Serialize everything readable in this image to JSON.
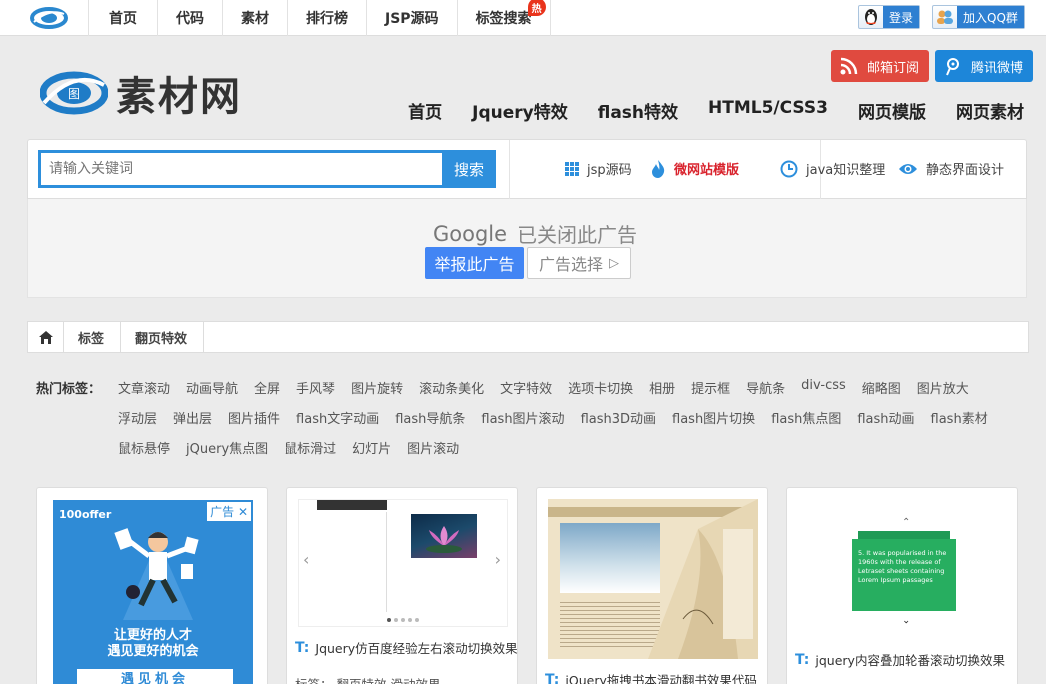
{
  "top_nav": {
    "items": [
      "首页",
      "代码",
      "素材",
      "排行榜",
      "JSP源码",
      "标签搜索"
    ],
    "hot_badge": "热",
    "login_label": "登录",
    "qq_group_label": "加入QQ群"
  },
  "brand": {
    "name": "素材网",
    "logo_mark": "图"
  },
  "subscribe": {
    "email_label": "邮箱订阅",
    "weibo_label": "腾讯微博"
  },
  "main_nav": {
    "items": [
      "首页",
      "Jquery特效",
      "flash特效",
      "HTML5/CSS3",
      "网页模版",
      "网页素材"
    ]
  },
  "search": {
    "placeholder": "请输入关键词",
    "button": "搜索"
  },
  "quick_links": [
    {
      "label": "jsp源码",
      "icon": "grid-icon"
    },
    {
      "label": "微网站模版",
      "icon": "flame-icon",
      "color": "#d9232d"
    },
    {
      "label": "java知识整理",
      "icon": "clock-icon"
    },
    {
      "label": "静态界面设计",
      "icon": "eye-icon"
    }
  ],
  "ad_banner": {
    "google": "Google",
    "closed_text": "已关闭此广告",
    "report_button": "举报此广告",
    "choice_button": "广告选择"
  },
  "breadcrumb": {
    "items": [
      "标签",
      "翻页特效"
    ]
  },
  "hot_tags": {
    "label": "热门标签：",
    "rows": [
      [
        "文章滚动",
        "动画导航",
        "全屏",
        "手风琴",
        "图片旋转",
        "滚动条美化",
        "文字特效",
        "选项卡切换",
        "相册",
        "提示框",
        "导航条",
        "div-css",
        "缩略图",
        "图片放大"
      ],
      [
        "浮动层",
        "弹出层",
        "图片插件",
        "flash文字动画",
        "flash导航条",
        "flash图片滚动",
        "flash3D动画",
        "flash图片切换",
        "flash焦点图",
        "flash动画",
        "flash素材"
      ],
      [
        "鼠标悬停",
        "jQuery焦点图",
        "鼠标滑过",
        "幻灯片",
        "图片滚动"
      ]
    ]
  },
  "cards": [
    {
      "type": "ad",
      "brand": "100offer",
      "badge": "广告",
      "line1": "让更好的人才",
      "line2": "遇见更好的机会",
      "cta": "遇见机会"
    },
    {
      "title_icon": "T:",
      "title": "Jquery仿百度经验左右滚动切换效果",
      "tags": "标签：  翻页特效   滑动效果"
    },
    {
      "title_icon": "T:",
      "title": "jQuery拖拽书本滑动翻书效果代码"
    },
    {
      "title_icon": "T:",
      "title": "jquery内容叠加轮番滚动切换效果",
      "preview_text": "5. It was popularised in the 1960s with the release of Letraset sheets containing Lorem Ipsum passages"
    }
  ],
  "colors": {
    "accent": "#2d8fdc",
    "email_red": "#e04a3f",
    "weibo_blue": "#1d86d9",
    "google_blue": "#4285f4"
  }
}
